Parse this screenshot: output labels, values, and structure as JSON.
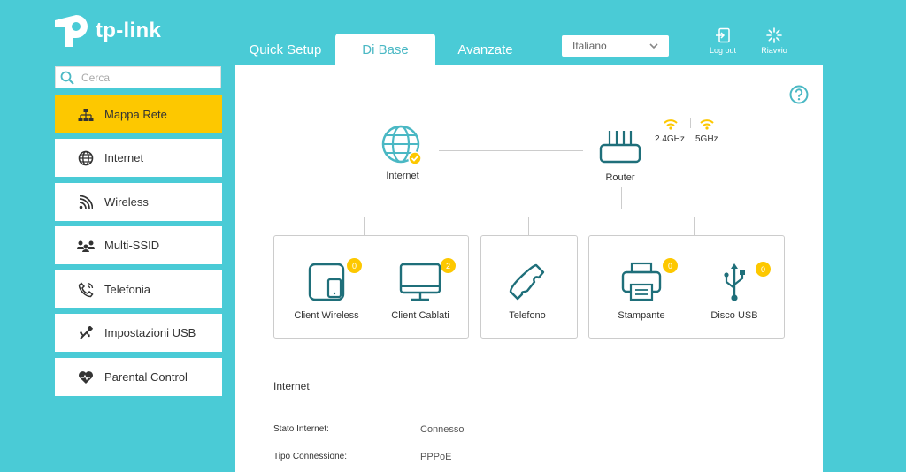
{
  "brand": {
    "name": "tp-link"
  },
  "tabs": [
    {
      "label": "Quick Setup",
      "active": false
    },
    {
      "label": "Di Base",
      "active": true
    },
    {
      "label": "Avanzate",
      "active": false
    }
  ],
  "language": {
    "selected": "Italiano"
  },
  "header_buttons": {
    "logout": "Log out",
    "reboot": "Riavvio"
  },
  "search": {
    "placeholder": "Cerca"
  },
  "sidebar": {
    "items": [
      {
        "label": "Mappa Rete",
        "icon": "network-map-icon",
        "active": true
      },
      {
        "label": "Internet",
        "icon": "globe-icon",
        "active": false
      },
      {
        "label": "Wireless",
        "icon": "wifi-icon",
        "active": false
      },
      {
        "label": "Multi-SSID",
        "icon": "users-icon",
        "active": false
      },
      {
        "label": "Telefonia",
        "icon": "phone-icon",
        "active": false
      },
      {
        "label": "Impostazioni USB",
        "icon": "usb-icon",
        "active": false
      },
      {
        "label": "Parental Control",
        "icon": "heart-icon",
        "active": false
      }
    ]
  },
  "map": {
    "internet": {
      "label": "Internet"
    },
    "router": {
      "label": "Router",
      "band1": "2.4GHz",
      "band2": "5GHz"
    },
    "devices": {
      "client_wireless": {
        "label": "Client Wireless",
        "count": "0"
      },
      "client_cablati": {
        "label": "Client Cablati",
        "count": "2"
      },
      "telefono": {
        "label": "Telefono"
      },
      "stampante": {
        "label": "Stampante",
        "count": "0"
      },
      "disco_usb": {
        "label": "Disco USB",
        "count": "0"
      }
    }
  },
  "internet_section": {
    "title": "Internet",
    "rows": [
      {
        "label": "Stato Internet:",
        "value": "Connesso"
      },
      {
        "label": "Tipo Connessione:",
        "value": "PPPoE"
      }
    ]
  },
  "colors": {
    "background": "#4acbd6",
    "accent": "#fdc800",
    "icon": "#1f6f7a",
    "active_tab_text": "#4ab8c4"
  }
}
